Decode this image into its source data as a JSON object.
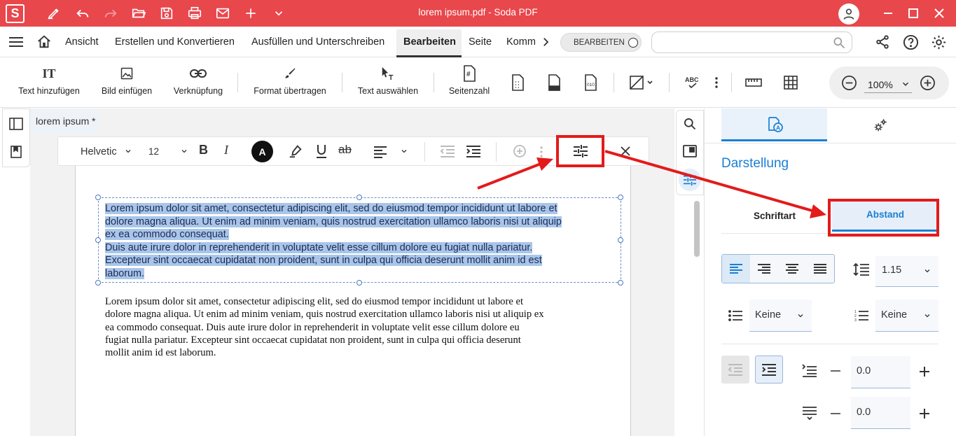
{
  "titlebar": {
    "title": "lorem ipsum.pdf  -  Soda PDF",
    "logo": "S"
  },
  "menubar": {
    "items": [
      "Ansicht",
      "Erstellen und Konvertieren",
      "Ausfüllen und Unterschreiben",
      "Bearbeiten",
      "Seite",
      "Komm"
    ],
    "active": "Bearbeiten",
    "mode_toggle": "BEARBEITEN",
    "search_placeholder": ""
  },
  "toolbar": {
    "buttons": [
      "Text hinzufügen",
      "Bild einfügen",
      "Verknüpfung",
      "Format übertragen",
      "Text auswählen",
      "Seitenzahl"
    ],
    "zoom": "100%"
  },
  "document": {
    "tab_title": "lorem ipsum",
    "tab_modified": "*",
    "format_bar": {
      "font": "Helvetic",
      "size": "12",
      "color_letter": "A"
    },
    "selected_lines": [
      "Lorem ipsum dolor sit amet, consectetur adipiscing elit, sed do eiusmod tempor incididunt ut labore et",
      "dolore magna aliqua. Ut enim ad minim veniam, quis nostrud exercitation ullamco laboris nisi ut aliquip",
      "ex ea commodo consequat.",
      "Duis aute irure dolor in reprehenderit in voluptate velit esse cillum dolore eu fugiat nulla pariatur.",
      "Excepteur sint occaecat cupidatat non proident, sunt in culpa qui officia deserunt mollit anim id est",
      "laborum."
    ],
    "body_lines": [
      "Lorem ipsum dolor sit amet, consectetur adipiscing elit, sed do eiusmod tempor incididunt ut labore et",
      "dolore magna aliqua. Ut enim ad minim veniam, quis nostrud exercitation ullamco laboris nisi ut aliquip ex",
      "ea commodo consequat. Duis aute irure dolor in reprehenderit in voluptate velit esse cillum dolore eu",
      "fugiat nulla pariatur. Excepteur sint occaecat cupidatat non proident, sunt in culpa qui officia deserunt",
      "mollit anim id est laborum."
    ]
  },
  "panel": {
    "section_title": "Darstellung",
    "subtabs": [
      "Schriftart",
      "Abstand"
    ],
    "active_subtab": "Abstand",
    "line_spacing": "1.15",
    "bullet_list": "Keine",
    "numbered_list": "Keine",
    "indent_before": "0.0",
    "indent_after": "0.0"
  },
  "colors": {
    "brand": "#e8474c",
    "accent": "#1a7fd4",
    "highlight": "#e31b1b"
  }
}
